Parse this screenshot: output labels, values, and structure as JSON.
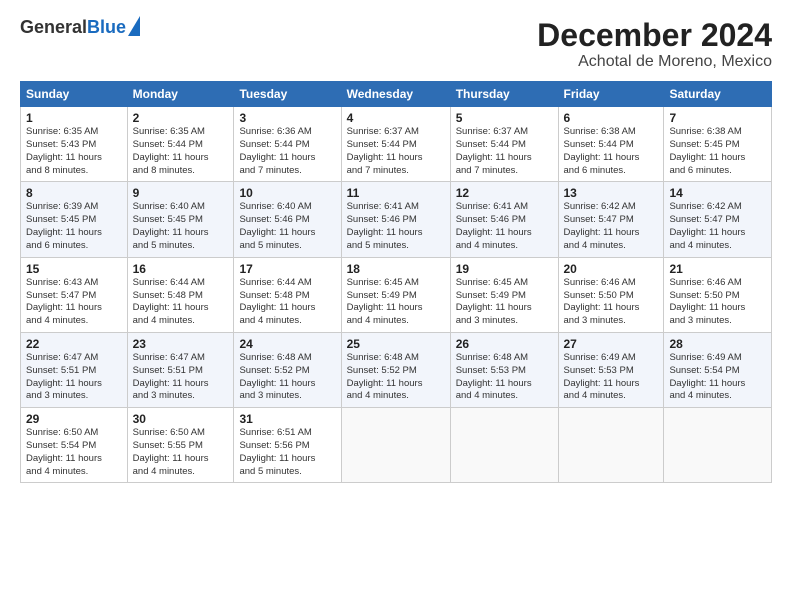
{
  "header": {
    "logo_line1": "General",
    "logo_line2": "Blue",
    "title": "December 2024",
    "subtitle": "Achotal de Moreno, Mexico"
  },
  "calendar": {
    "headers": [
      "Sunday",
      "Monday",
      "Tuesday",
      "Wednesday",
      "Thursday",
      "Friday",
      "Saturday"
    ],
    "weeks": [
      [
        {
          "day": "1",
          "info": "Sunrise: 6:35 AM\nSunset: 5:43 PM\nDaylight: 11 hours\nand 8 minutes."
        },
        {
          "day": "2",
          "info": "Sunrise: 6:35 AM\nSunset: 5:44 PM\nDaylight: 11 hours\nand 8 minutes."
        },
        {
          "day": "3",
          "info": "Sunrise: 6:36 AM\nSunset: 5:44 PM\nDaylight: 11 hours\nand 7 minutes."
        },
        {
          "day": "4",
          "info": "Sunrise: 6:37 AM\nSunset: 5:44 PM\nDaylight: 11 hours\nand 7 minutes."
        },
        {
          "day": "5",
          "info": "Sunrise: 6:37 AM\nSunset: 5:44 PM\nDaylight: 11 hours\nand 7 minutes."
        },
        {
          "day": "6",
          "info": "Sunrise: 6:38 AM\nSunset: 5:44 PM\nDaylight: 11 hours\nand 6 minutes."
        },
        {
          "day": "7",
          "info": "Sunrise: 6:38 AM\nSunset: 5:45 PM\nDaylight: 11 hours\nand 6 minutes."
        }
      ],
      [
        {
          "day": "8",
          "info": "Sunrise: 6:39 AM\nSunset: 5:45 PM\nDaylight: 11 hours\nand 6 minutes."
        },
        {
          "day": "9",
          "info": "Sunrise: 6:40 AM\nSunset: 5:45 PM\nDaylight: 11 hours\nand 5 minutes."
        },
        {
          "day": "10",
          "info": "Sunrise: 6:40 AM\nSunset: 5:46 PM\nDaylight: 11 hours\nand 5 minutes."
        },
        {
          "day": "11",
          "info": "Sunrise: 6:41 AM\nSunset: 5:46 PM\nDaylight: 11 hours\nand 5 minutes."
        },
        {
          "day": "12",
          "info": "Sunrise: 6:41 AM\nSunset: 5:46 PM\nDaylight: 11 hours\nand 4 minutes."
        },
        {
          "day": "13",
          "info": "Sunrise: 6:42 AM\nSunset: 5:47 PM\nDaylight: 11 hours\nand 4 minutes."
        },
        {
          "day": "14",
          "info": "Sunrise: 6:42 AM\nSunset: 5:47 PM\nDaylight: 11 hours\nand 4 minutes."
        }
      ],
      [
        {
          "day": "15",
          "info": "Sunrise: 6:43 AM\nSunset: 5:47 PM\nDaylight: 11 hours\nand 4 minutes."
        },
        {
          "day": "16",
          "info": "Sunrise: 6:44 AM\nSunset: 5:48 PM\nDaylight: 11 hours\nand 4 minutes."
        },
        {
          "day": "17",
          "info": "Sunrise: 6:44 AM\nSunset: 5:48 PM\nDaylight: 11 hours\nand 4 minutes."
        },
        {
          "day": "18",
          "info": "Sunrise: 6:45 AM\nSunset: 5:49 PM\nDaylight: 11 hours\nand 4 minutes."
        },
        {
          "day": "19",
          "info": "Sunrise: 6:45 AM\nSunset: 5:49 PM\nDaylight: 11 hours\nand 3 minutes."
        },
        {
          "day": "20",
          "info": "Sunrise: 6:46 AM\nSunset: 5:50 PM\nDaylight: 11 hours\nand 3 minutes."
        },
        {
          "day": "21",
          "info": "Sunrise: 6:46 AM\nSunset: 5:50 PM\nDaylight: 11 hours\nand 3 minutes."
        }
      ],
      [
        {
          "day": "22",
          "info": "Sunrise: 6:47 AM\nSunset: 5:51 PM\nDaylight: 11 hours\nand 3 minutes."
        },
        {
          "day": "23",
          "info": "Sunrise: 6:47 AM\nSunset: 5:51 PM\nDaylight: 11 hours\nand 3 minutes."
        },
        {
          "day": "24",
          "info": "Sunrise: 6:48 AM\nSunset: 5:52 PM\nDaylight: 11 hours\nand 3 minutes."
        },
        {
          "day": "25",
          "info": "Sunrise: 6:48 AM\nSunset: 5:52 PM\nDaylight: 11 hours\nand 4 minutes."
        },
        {
          "day": "26",
          "info": "Sunrise: 6:48 AM\nSunset: 5:53 PM\nDaylight: 11 hours\nand 4 minutes."
        },
        {
          "day": "27",
          "info": "Sunrise: 6:49 AM\nSunset: 5:53 PM\nDaylight: 11 hours\nand 4 minutes."
        },
        {
          "day": "28",
          "info": "Sunrise: 6:49 AM\nSunset: 5:54 PM\nDaylight: 11 hours\nand 4 minutes."
        }
      ],
      [
        {
          "day": "29",
          "info": "Sunrise: 6:50 AM\nSunset: 5:54 PM\nDaylight: 11 hours\nand 4 minutes."
        },
        {
          "day": "30",
          "info": "Sunrise: 6:50 AM\nSunset: 5:55 PM\nDaylight: 11 hours\nand 4 minutes."
        },
        {
          "day": "31",
          "info": "Sunrise: 6:51 AM\nSunset: 5:56 PM\nDaylight: 11 hours\nand 5 minutes."
        },
        {
          "day": "",
          "info": ""
        },
        {
          "day": "",
          "info": ""
        },
        {
          "day": "",
          "info": ""
        },
        {
          "day": "",
          "info": ""
        }
      ]
    ]
  }
}
